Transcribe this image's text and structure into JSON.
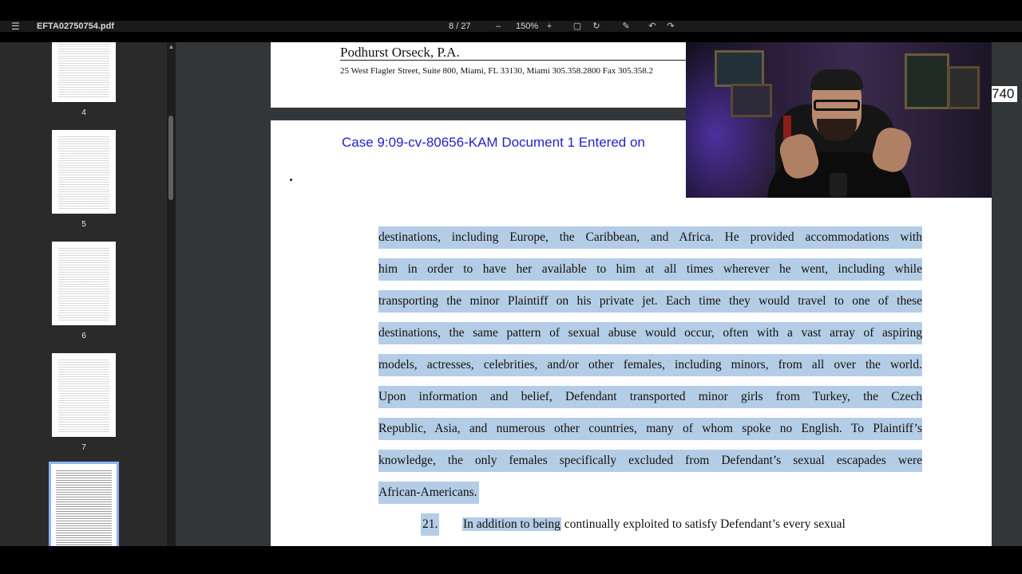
{
  "toolbar": {
    "file_name": "EFTA02750754.pdf",
    "page_indicator": "8 / 27",
    "zoom_level": "150%"
  },
  "sidebar": {
    "thumbnails": [
      {
        "label": "4"
      },
      {
        "label": "5"
      },
      {
        "label": "6"
      },
      {
        "label": "7"
      }
    ],
    "active_page": "8"
  },
  "document": {
    "previous_page": {
      "firm_name": "Podhurst Orseck, P.A.",
      "firm_address": "25 West Flagler Street, Suite 800, Miami, FL 33130, Miami 305.358.2800  Fax 305.358.2"
    },
    "current_page": {
      "case_header": "Case 9:09-cv-80656-KAM    Document 1    Entered on",
      "lines": [
        "destinations, including Europe, the Caribbean, and Africa.  He provided accommodations with",
        "him in order to have her available to him at all times wherever he went, including while",
        "transporting the minor Plaintiff on his private jet.  Each time they would travel to one of these",
        "destinations, the same pattern of sexual abuse would occur, often with a vast array of aspiring",
        "models, actresses, celebrities, and/or other females, including minors, from all over the world.",
        "Upon information and belief, Defendant transported minor girls from Turkey, the Czech",
        "Republic, Asia, and numerous other countries, many of whom spoke no English.  To Plaintiff’s",
        "knowledge, the only females specifically excluded from Defendant’s sexual escapades were",
        "African-Americans."
      ],
      "paragraph_number": "21.",
      "last_line_highlighted": "In addition to being",
      "last_line_rest": " continually exploited to satisfy Defendant’s every sexual"
    },
    "side_text": "740"
  },
  "colors": {
    "highlight": "#b4cde6",
    "case_header": "#2323c8",
    "sidebar_bg": "#2a2a2a",
    "viewer_bg": "#333639"
  }
}
